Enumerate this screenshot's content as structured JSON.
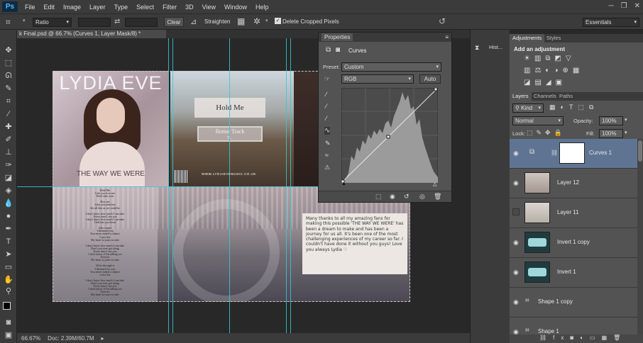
{
  "app": {
    "logo": "Ps",
    "menu": [
      "File",
      "Edit",
      "Image",
      "Layer",
      "Type",
      "Select",
      "Filter",
      "3D",
      "View",
      "Window",
      "Help"
    ]
  },
  "options": {
    "ratio": "Ratio",
    "clear": "Clear",
    "straighten": "Straighten",
    "delete_cropped": "Delete Cropped Pixels",
    "workspace": "Essentials"
  },
  "document": {
    "tab_title": "k Final.psd @ 66.7% (Curves 1, Layer Mask/8) *",
    "status_zoom": "66.67%",
    "status_doc": "Doc: 2.39M/60.7M"
  },
  "artwork": {
    "artist": "LYDIA EVE",
    "subtitle": "THE WAY WE WERE",
    "track1": "Hold Me",
    "track2": "Bonus Track",
    "track2_sub": "T...",
    "url": "WWW.LYDIAEVEMUSIC.CO.UK",
    "lyrics": [
      "Hold Me",
      "Like you love me",
      "Don't take your",
      "",
      "Kiss me",
      "Like you need me",
      "Set all this as we could be",
      "",
      "I don't know how much I can take",
      "Every time I see you",
      "I don't know how much I can take",
      "I fall into you heart",
      "",
      "Like winter",
      "I dreamed you",
      "You never ended a chance",
      "I was lost",
      "My heart is yours to take",
      "",
      "I don't know how much I can take",
      "Don't you ever got along",
      "Every time I see you",
      "I don't know if I'm falling too",
      "Forever",
      "My heart is yours to take",
      "",
      "We're through it",
      "I dreamed for you",
      "You never ended a chance",
      "I was lost",
      "",
      "I don't know how much I can take",
      "Don't you ever got along",
      "Every time I see you",
      "I don't know if I'm falling too",
      "Forever",
      "My heart is yours to take"
    ],
    "note": "Many thanks to all my amazing fans for making this possible 'THE WAY WE WERE' has been a dream to make and has been a journey for us all. It's been one of the most challenging experiences of my career so far. I couldn't have done it without you guys! Love you always Lydia ♡"
  },
  "properties": {
    "panel_title": "Properties",
    "type": "Curves",
    "preset_label": "Preset:",
    "preset": "Custom",
    "channel": "RGB",
    "auto": "Auto"
  },
  "history": {
    "label": "Hist..."
  },
  "adjustments": {
    "tab": "Adjustments",
    "tab2": "Styles",
    "heading": "Add an adjustment"
  },
  "layers": {
    "tabs": [
      "Layers",
      "Channels",
      "Paths"
    ],
    "kind": "Kind",
    "blend": "Normal",
    "opacity_label": "Opacity:",
    "opacity": "100%",
    "lock_label": "Lock:",
    "fill_label": "Fill:",
    "fill": "100%",
    "items": [
      {
        "name": "Curves 1",
        "visible": true,
        "selected": true
      },
      {
        "name": "Layer 12",
        "visible": true
      },
      {
        "name": "Layer 11",
        "visible": false
      },
      {
        "name": "Invert 1 copy",
        "visible": true
      },
      {
        "name": "Invert 1",
        "visible": true
      },
      {
        "name": "Shape 1 copy",
        "visible": true
      },
      {
        "name": "Shape 1",
        "visible": true
      }
    ]
  },
  "colors": {
    "accent_selected": "#5f7493",
    "guide": "#37c8d8",
    "panel_bg": "#535353"
  }
}
